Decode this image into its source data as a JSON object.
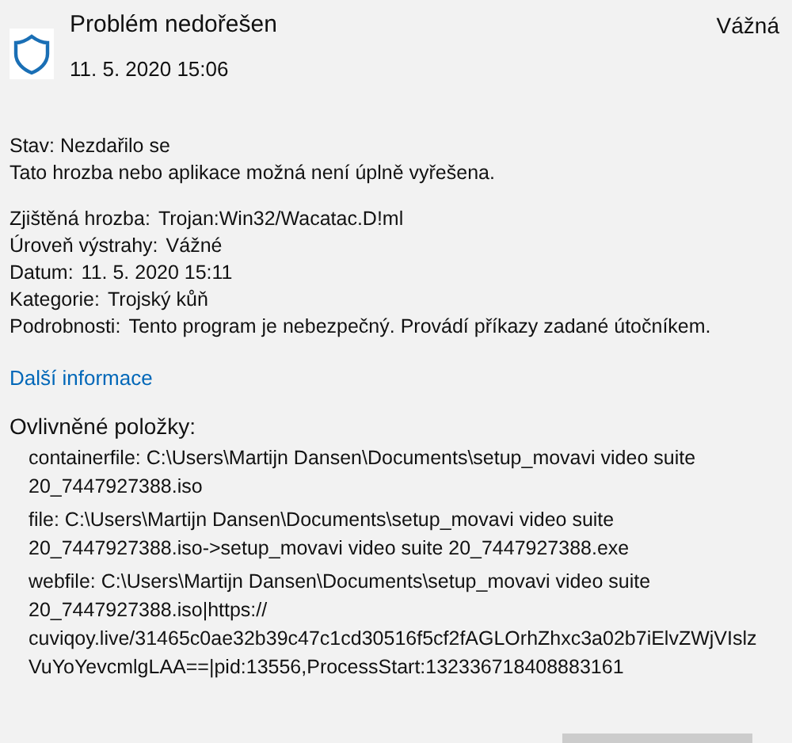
{
  "header": {
    "title": "Problém nedořešen",
    "date": "11. 5. 2020 15:06",
    "severity": "Vážná"
  },
  "status": {
    "state": "Stav: Nezdařilo se",
    "note": "Tato hrozba nebo aplikace možná není úplně vyřešena."
  },
  "details": [
    {
      "label": "Zjištěná hrozba:",
      "value": "Trojan:Win32/Wacatac.D!ml"
    },
    {
      "label": "Úroveň výstrahy:",
      "value": "Vážné"
    },
    {
      "label": "Datum:",
      "value": "11. 5. 2020 15:11"
    },
    {
      "label": "Kategorie:",
      "value": "Trojský kůň"
    },
    {
      "label": "Podrobnosti:",
      "value": "Tento program je nebezpečný. Provádí příkazy zadané útočníkem."
    }
  ],
  "more_info_link": "Další informace",
  "affected": {
    "heading": "Ovlivněné položky:",
    "items": [
      {
        "lines": [
          "containerfile: C:\\Users\\Martijn Dansen\\Documents\\setup_movavi video suite",
          "20_7447927388.iso"
        ]
      },
      {
        "lines": [
          "file: C:\\Users\\Martijn Dansen\\Documents\\setup_movavi video suite",
          "20_7447927388.iso->setup_movavi video suite 20_7447927388.exe"
        ]
      },
      {
        "lines": [
          "webfile: C:\\Users\\Martijn Dansen\\Documents\\setup_movavi video suite",
          "20_7447927388.iso|https://",
          "cuviqoy.live/31465c0ae32b39c47c1cd30516f5cf2fAGLOrhZhxc3a02b7iElvZWjVIslz",
          "VuYoYevcmlgLAA==|pid:13556,ProcessStart:132336718408883161"
        ]
      }
    ]
  },
  "footer_button": {
    "kind": "button"
  }
}
